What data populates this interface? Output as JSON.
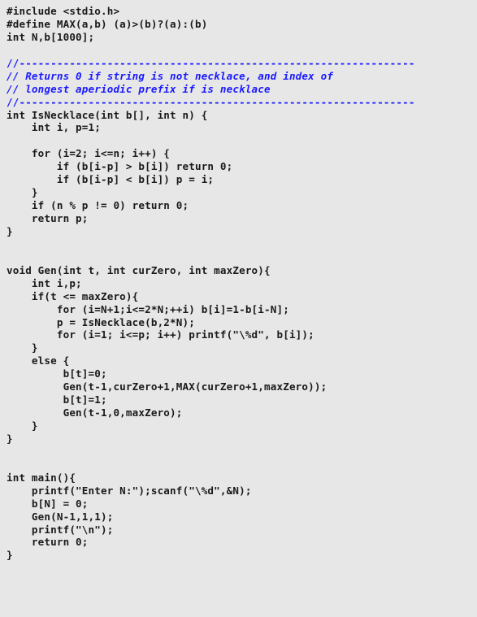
{
  "document": {
    "kind": "source-code-listing",
    "language": "C",
    "background_color": "#e7e7e7",
    "code_color": "#1a1a1a",
    "comment_color": "#1a1aff",
    "lines": [
      {
        "kind": "code",
        "text": "#include <stdio.h>"
      },
      {
        "kind": "code",
        "text": "#define MAX(a,b) (a)>(b)?(a):(b)"
      },
      {
        "kind": "code",
        "text": "int N,b[1000];"
      },
      {
        "kind": "blank",
        "text": ""
      },
      {
        "kind": "rule",
        "text": "//---------------------------------------------------------------"
      },
      {
        "kind": "comment",
        "text": "// Returns 0 if string is not necklace, and index of"
      },
      {
        "kind": "comment",
        "text": "// longest aperiodic prefix if is necklace"
      },
      {
        "kind": "rule",
        "text": "//---------------------------------------------------------------"
      },
      {
        "kind": "code",
        "text": "int IsNecklace(int b[], int n) {"
      },
      {
        "kind": "code",
        "text": "    int i, p=1;"
      },
      {
        "kind": "blank",
        "text": ""
      },
      {
        "kind": "code",
        "text": "    for (i=2; i<=n; i++) {"
      },
      {
        "kind": "code",
        "text": "        if (b[i-p] > b[i]) return 0;"
      },
      {
        "kind": "code",
        "text": "        if (b[i-p] < b[i]) p = i;"
      },
      {
        "kind": "code",
        "text": "    }"
      },
      {
        "kind": "code",
        "text": "    if (n % p != 0) return 0;"
      },
      {
        "kind": "code",
        "text": "    return p;"
      },
      {
        "kind": "code",
        "text": "}"
      },
      {
        "kind": "blank",
        "text": ""
      },
      {
        "kind": "blank",
        "text": ""
      },
      {
        "kind": "code",
        "text": "void Gen(int t, int curZero, int maxZero){"
      },
      {
        "kind": "code",
        "text": "    int i,p;"
      },
      {
        "kind": "code",
        "text": "    if(t <= maxZero){"
      },
      {
        "kind": "code",
        "text": "        for (i=N+1;i<=2*N;++i) b[i]=1-b[i-N];"
      },
      {
        "kind": "code",
        "text": "        p = IsNecklace(b,2*N);"
      },
      {
        "kind": "code",
        "text": "        for (i=1; i<=p; i++) printf(\"\\%d\", b[i]);"
      },
      {
        "kind": "code",
        "text": "    }"
      },
      {
        "kind": "code",
        "text": "    else {"
      },
      {
        "kind": "code",
        "text": "         b[t]=0;"
      },
      {
        "kind": "code",
        "text": "         Gen(t-1,curZero+1,MAX(curZero+1,maxZero));"
      },
      {
        "kind": "code",
        "text": "         b[t]=1;"
      },
      {
        "kind": "code",
        "text": "         Gen(t-1,0,maxZero);"
      },
      {
        "kind": "code",
        "text": "    }"
      },
      {
        "kind": "code",
        "text": "}"
      },
      {
        "kind": "blank",
        "text": ""
      },
      {
        "kind": "blank",
        "text": ""
      },
      {
        "kind": "code",
        "text": "int main(){"
      },
      {
        "kind": "code",
        "text": "    printf(\"Enter N:\");scanf(\"\\%d\",&N);"
      },
      {
        "kind": "code",
        "text": "    b[N] = 0;"
      },
      {
        "kind": "code",
        "text": "    Gen(N-1,1,1);"
      },
      {
        "kind": "code",
        "text": "    printf(\"\\n\");"
      },
      {
        "kind": "code",
        "text": "    return 0;"
      },
      {
        "kind": "code",
        "text": "}"
      }
    ]
  }
}
